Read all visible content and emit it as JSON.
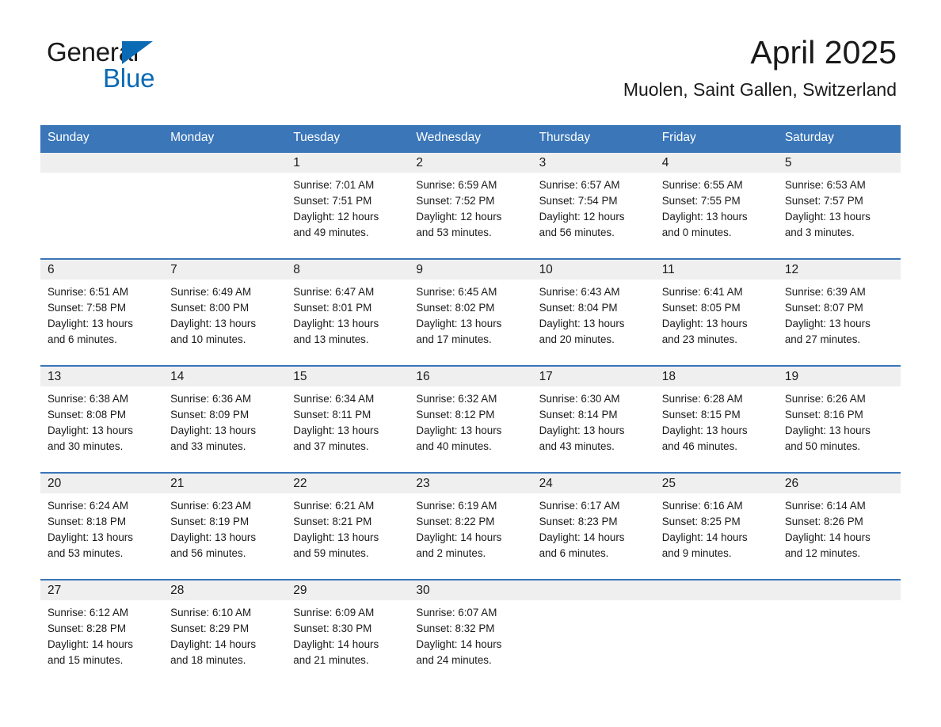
{
  "brand": {
    "name_dark": "General",
    "name_blue": "Blue",
    "triangle_color": "#0a6ab4"
  },
  "header": {
    "title": "April 2025",
    "subtitle": "Muolen, Saint Gallen, Switzerland",
    "header_bg": "#3a76b8",
    "daynum_bg": "#efeff0",
    "divider_color": "#3a76b8"
  },
  "weekday_headers": [
    "Sunday",
    "Monday",
    "Tuesday",
    "Wednesday",
    "Thursday",
    "Friday",
    "Saturday"
  ],
  "weeks": [
    [
      {
        "day": "",
        "lines": []
      },
      {
        "day": "",
        "lines": []
      },
      {
        "day": "1",
        "lines": [
          "Sunrise: 7:01 AM",
          "Sunset: 7:51 PM",
          "Daylight: 12 hours",
          "and 49 minutes."
        ]
      },
      {
        "day": "2",
        "lines": [
          "Sunrise: 6:59 AM",
          "Sunset: 7:52 PM",
          "Daylight: 12 hours",
          "and 53 minutes."
        ]
      },
      {
        "day": "3",
        "lines": [
          "Sunrise: 6:57 AM",
          "Sunset: 7:54 PM",
          "Daylight: 12 hours",
          "and 56 minutes."
        ]
      },
      {
        "day": "4",
        "lines": [
          "Sunrise: 6:55 AM",
          "Sunset: 7:55 PM",
          "Daylight: 13 hours",
          "and 0 minutes."
        ]
      },
      {
        "day": "5",
        "lines": [
          "Sunrise: 6:53 AM",
          "Sunset: 7:57 PM",
          "Daylight: 13 hours",
          "and 3 minutes."
        ]
      }
    ],
    [
      {
        "day": "6",
        "lines": [
          "Sunrise: 6:51 AM",
          "Sunset: 7:58 PM",
          "Daylight: 13 hours",
          "and 6 minutes."
        ]
      },
      {
        "day": "7",
        "lines": [
          "Sunrise: 6:49 AM",
          "Sunset: 8:00 PM",
          "Daylight: 13 hours",
          "and 10 minutes."
        ]
      },
      {
        "day": "8",
        "lines": [
          "Sunrise: 6:47 AM",
          "Sunset: 8:01 PM",
          "Daylight: 13 hours",
          "and 13 minutes."
        ]
      },
      {
        "day": "9",
        "lines": [
          "Sunrise: 6:45 AM",
          "Sunset: 8:02 PM",
          "Daylight: 13 hours",
          "and 17 minutes."
        ]
      },
      {
        "day": "10",
        "lines": [
          "Sunrise: 6:43 AM",
          "Sunset: 8:04 PM",
          "Daylight: 13 hours",
          "and 20 minutes."
        ]
      },
      {
        "day": "11",
        "lines": [
          "Sunrise: 6:41 AM",
          "Sunset: 8:05 PM",
          "Daylight: 13 hours",
          "and 23 minutes."
        ]
      },
      {
        "day": "12",
        "lines": [
          "Sunrise: 6:39 AM",
          "Sunset: 8:07 PM",
          "Daylight: 13 hours",
          "and 27 minutes."
        ]
      }
    ],
    [
      {
        "day": "13",
        "lines": [
          "Sunrise: 6:38 AM",
          "Sunset: 8:08 PM",
          "Daylight: 13 hours",
          "and 30 minutes."
        ]
      },
      {
        "day": "14",
        "lines": [
          "Sunrise: 6:36 AM",
          "Sunset: 8:09 PM",
          "Daylight: 13 hours",
          "and 33 minutes."
        ]
      },
      {
        "day": "15",
        "lines": [
          "Sunrise: 6:34 AM",
          "Sunset: 8:11 PM",
          "Daylight: 13 hours",
          "and 37 minutes."
        ]
      },
      {
        "day": "16",
        "lines": [
          "Sunrise: 6:32 AM",
          "Sunset: 8:12 PM",
          "Daylight: 13 hours",
          "and 40 minutes."
        ]
      },
      {
        "day": "17",
        "lines": [
          "Sunrise: 6:30 AM",
          "Sunset: 8:14 PM",
          "Daylight: 13 hours",
          "and 43 minutes."
        ]
      },
      {
        "day": "18",
        "lines": [
          "Sunrise: 6:28 AM",
          "Sunset: 8:15 PM",
          "Daylight: 13 hours",
          "and 46 minutes."
        ]
      },
      {
        "day": "19",
        "lines": [
          "Sunrise: 6:26 AM",
          "Sunset: 8:16 PM",
          "Daylight: 13 hours",
          "and 50 minutes."
        ]
      }
    ],
    [
      {
        "day": "20",
        "lines": [
          "Sunrise: 6:24 AM",
          "Sunset: 8:18 PM",
          "Daylight: 13 hours",
          "and 53 minutes."
        ]
      },
      {
        "day": "21",
        "lines": [
          "Sunrise: 6:23 AM",
          "Sunset: 8:19 PM",
          "Daylight: 13 hours",
          "and 56 minutes."
        ]
      },
      {
        "day": "22",
        "lines": [
          "Sunrise: 6:21 AM",
          "Sunset: 8:21 PM",
          "Daylight: 13 hours",
          "and 59 minutes."
        ]
      },
      {
        "day": "23",
        "lines": [
          "Sunrise: 6:19 AM",
          "Sunset: 8:22 PM",
          "Daylight: 14 hours",
          "and 2 minutes."
        ]
      },
      {
        "day": "24",
        "lines": [
          "Sunrise: 6:17 AM",
          "Sunset: 8:23 PM",
          "Daylight: 14 hours",
          "and 6 minutes."
        ]
      },
      {
        "day": "25",
        "lines": [
          "Sunrise: 6:16 AM",
          "Sunset: 8:25 PM",
          "Daylight: 14 hours",
          "and 9 minutes."
        ]
      },
      {
        "day": "26",
        "lines": [
          "Sunrise: 6:14 AM",
          "Sunset: 8:26 PM",
          "Daylight: 14 hours",
          "and 12 minutes."
        ]
      }
    ],
    [
      {
        "day": "27",
        "lines": [
          "Sunrise: 6:12 AM",
          "Sunset: 8:28 PM",
          "Daylight: 14 hours",
          "and 15 minutes."
        ]
      },
      {
        "day": "28",
        "lines": [
          "Sunrise: 6:10 AM",
          "Sunset: 8:29 PM",
          "Daylight: 14 hours",
          "and 18 minutes."
        ]
      },
      {
        "day": "29",
        "lines": [
          "Sunrise: 6:09 AM",
          "Sunset: 8:30 PM",
          "Daylight: 14 hours",
          "and 21 minutes."
        ]
      },
      {
        "day": "30",
        "lines": [
          "Sunrise: 6:07 AM",
          "Sunset: 8:32 PM",
          "Daylight: 14 hours",
          "and 24 minutes."
        ]
      },
      {
        "day": "",
        "lines": []
      },
      {
        "day": "",
        "lines": []
      },
      {
        "day": "",
        "lines": []
      }
    ]
  ]
}
